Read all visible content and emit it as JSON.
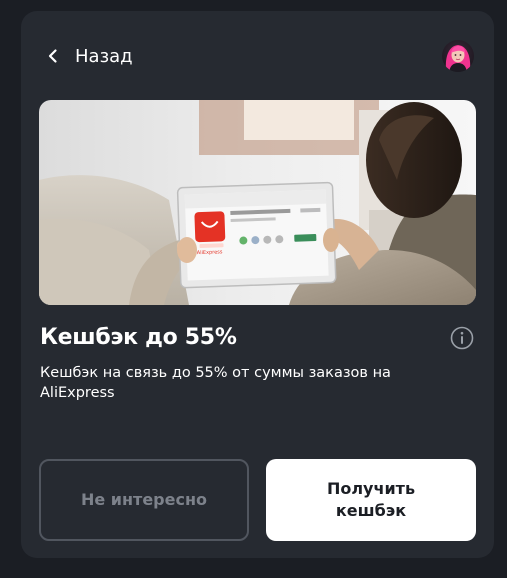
{
  "header": {
    "back_label": "Назад",
    "back_icon": "chevron-left-icon",
    "avatar_icon": "user-avatar"
  },
  "offer": {
    "title": "Кешбэк до 55%",
    "description": "Кешбэк на связь до 55% от суммы заказов на AliExpress",
    "info_icon": "info-icon",
    "hero_image": "person-holding-tablet-with-aliexpress-app",
    "hero_app_name": "AliExpress"
  },
  "actions": {
    "decline_label": "Не интересно",
    "accept_label": "Получить кешбэк"
  },
  "colors": {
    "background": "#1b1e24",
    "card": "#262a31",
    "primary_button": "#ffffff",
    "secondary_border": "#51565f",
    "secondary_text": "#7d828b",
    "aliexpress_red": "#e43225"
  }
}
